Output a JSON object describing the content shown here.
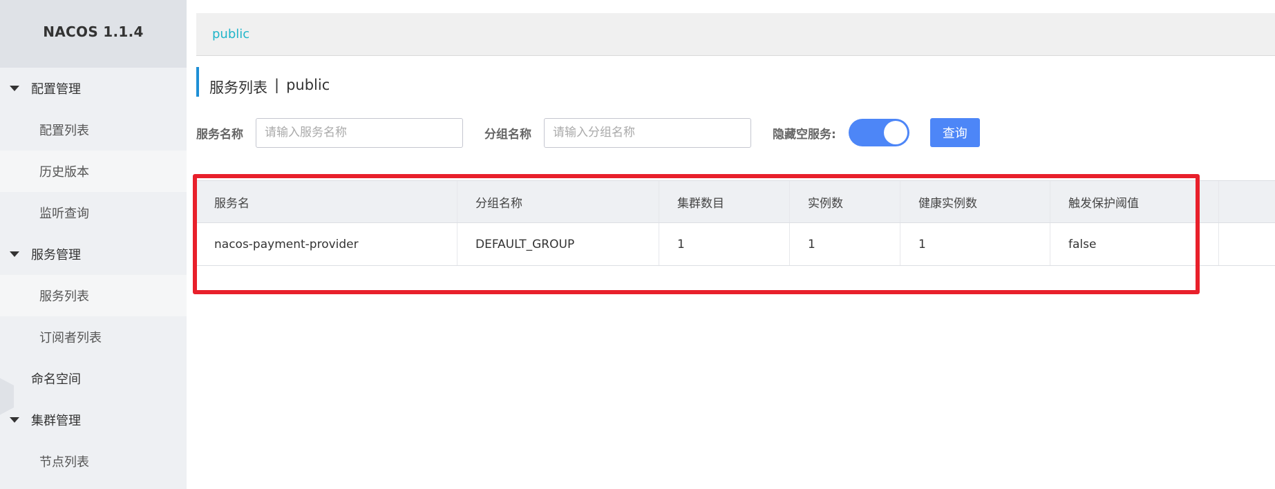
{
  "app": {
    "title": "NACOS 1.1.4"
  },
  "sidebar": {
    "items": [
      {
        "label": "配置管理",
        "type": "group"
      },
      {
        "label": "配置列表",
        "type": "sub"
      },
      {
        "label": "历史版本",
        "type": "sub"
      },
      {
        "label": "监听查询",
        "type": "sub"
      },
      {
        "label": "服务管理",
        "type": "group"
      },
      {
        "label": "服务列表",
        "type": "sub"
      },
      {
        "label": "订阅者列表",
        "type": "sub"
      },
      {
        "label": "命名空间",
        "type": "link"
      },
      {
        "label": "集群管理",
        "type": "group"
      },
      {
        "label": "节点列表",
        "type": "sub"
      }
    ]
  },
  "namespace_bar": {
    "label": "public"
  },
  "page": {
    "title": "服务列表",
    "separator": "|",
    "namespace": "public"
  },
  "filters": {
    "service_label": "服务名称",
    "service_placeholder": "请输入服务名称",
    "group_label": "分组名称",
    "group_placeholder": "请输入分组名称",
    "hide_empty_label": "隐藏空服务:",
    "hide_empty_on": true,
    "query_label": "查询"
  },
  "table": {
    "headers": [
      "服务名",
      "分组名称",
      "集群数目",
      "实例数",
      "健康实例数",
      "触发保护阈值",
      ""
    ],
    "rows": [
      [
        "nacos-payment-provider",
        "DEFAULT_GROUP",
        "1",
        "1",
        "1",
        "false",
        ""
      ]
    ]
  },
  "colors": {
    "accent": "#4d86f7",
    "link": "#1fb5c9",
    "highlight": "#e8202b"
  }
}
